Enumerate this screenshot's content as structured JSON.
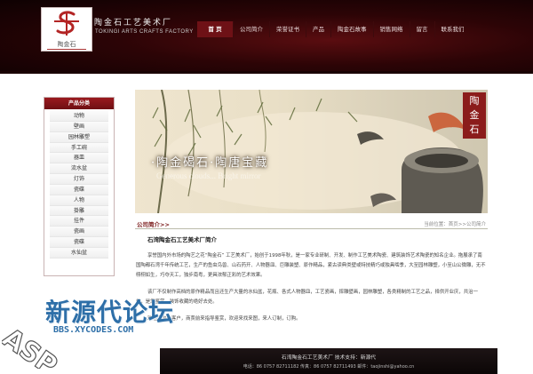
{
  "header": {
    "logo_text": "陶金石",
    "brand_cn": "陶金石工艺美术厂",
    "brand_en": "TOKINGI ARTS CRAFTS FACTORY"
  },
  "nav": {
    "items": [
      "首 页",
      "公司简介",
      "荣誉证书",
      "产品",
      "陶金石故事",
      "销售网络",
      "留言",
      "联系我们"
    ]
  },
  "sidebar": {
    "title": "产品分类",
    "items": [
      "动物",
      "壁画",
      "园林雕塑",
      "手工碗",
      "器皿",
      "流水盆",
      "灯饰",
      "瓷碟",
      "人物",
      "掛雕",
      "挂件",
      "瓷画",
      "瓷碟",
      "水仙盆"
    ]
  },
  "banner": {
    "slogan": "·陶金碣石·陶唐宝藏",
    "slogan_en": "Generous clouds... Bright mirror",
    "seal": [
      "陶",
      "金",
      "石"
    ]
  },
  "content": {
    "section_title": "公司简介>>",
    "breadcrumb": "当前位置：首页>>公司简介",
    "article_title": "石湾陶金石工艺美术厂简介",
    "para_1": "享誉国内外市场的陶艺之花“陶金石” 工艺美术厂，始创于1998年秋，是一家专业研制、开发、制作工艺美术陶瓷、建筑装饰艺术陶瓷的知名企业。拖展承了南国陶都石湾千年传统工艺，生产的鱼虫鸟兽、山石药开、人物器皿、巨雕装塑、原作精品，紧古读典类壁或特技精巧或独具啮季，大至园林雕塑，小至山公微雕，无不栩栩如生，巧夺天工，独步南粤，更具浓郁正彩的艺术效果。",
    "para_2": "该厂不仅制作高档的原作精品而且还生产大量的水仙盆，花瓶、各式人物器皿，工艺瓷画，摔雕壁画，园林雕塑，各类精制的工艺之品，择供开业庆，共治一炉，是您鉴赏，装饰收藏的绝好去处。",
    "para_3": "欢迎海内外客户，商贾前来指导鉴赏，欢迎来找来图，来人订制，订购。"
  },
  "watermark": {
    "chinese": "新源代论坛",
    "url": "BBS.XYCODES.COM",
    "asp": "ASP"
  },
  "footer": {
    "line_1": "石湾陶金石工艺美术厂  技术支持：新源代",
    "line_2": "电话：86 0757 82711182  传真：86 0757 82711493  邮件：taojinshi@yahoo.cn"
  },
  "colors": {
    "header_bg": "#2c0406",
    "accent_red": "#7a1a1a",
    "watermark_blue": "#2e6fa8"
  }
}
